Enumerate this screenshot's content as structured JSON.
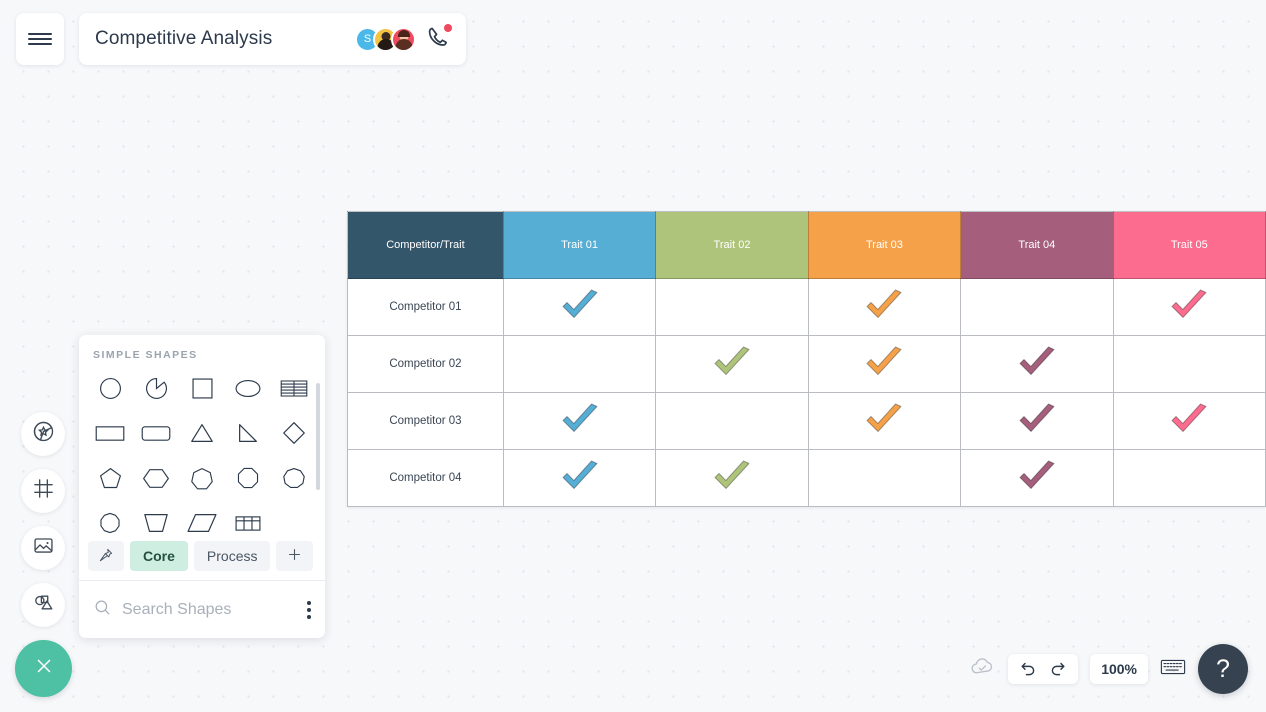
{
  "app": {
    "document_title": "Competitive Analysis"
  },
  "topbar": {
    "menu_icon": "hamburger-menu-icon",
    "phone_icon": "phone-call-icon",
    "collaborators": [
      {
        "initial": "S",
        "name": "collaborator-avatar-s",
        "color": "#4ab8e8"
      },
      {
        "initial": "",
        "name": "collaborator-avatar-2",
        "color": "#f5c344"
      },
      {
        "initial": "",
        "name": "collaborator-avatar-3",
        "color": "#f04a5e"
      }
    ]
  },
  "left_rail": {
    "items": [
      {
        "icon": "sticker-star-icon",
        "label": "Stickers"
      },
      {
        "icon": "frame-icon",
        "label": "Frame"
      },
      {
        "icon": "image-icon",
        "label": "Image"
      },
      {
        "icon": "shapes-icon",
        "label": "Shapes"
      }
    ],
    "close_icon": "close-x-icon",
    "close_color": "#4ec0a3"
  },
  "shapes_panel": {
    "heading": "SIMPLE SHAPES",
    "shapes": [
      "circle",
      "arc-partial-circle",
      "square",
      "ellipse",
      "table-striped",
      "rectangle",
      "rounded-rectangle",
      "triangle",
      "right-triangle",
      "diamond",
      "pentagon",
      "hexagon",
      "heptagon",
      "octagon",
      "nonagon",
      "decagon",
      "trapezoid",
      "parallelogram",
      "grid-table"
    ],
    "tabs": [
      {
        "label": "",
        "icon": "pin-icon",
        "active": false
      },
      {
        "label": "Core",
        "icon": "",
        "active": true
      },
      {
        "label": "Process",
        "icon": "",
        "active": false
      },
      {
        "label": "",
        "icon": "plus-icon",
        "active": false
      }
    ],
    "search_placeholder": "Search Shapes",
    "search_value": "",
    "search_icon": "search-icon",
    "more_icon": "more-vertical-icon"
  },
  "chart_data": {
    "type": "table",
    "title": "Competitive Analysis",
    "corner_label": "Competitor/Trait",
    "columns": [
      {
        "label": "Trait 01",
        "color": "#56aed5"
      },
      {
        "label": "Trait 02",
        "color": "#afc47b"
      },
      {
        "label": "Trait 03",
        "color": "#f5a council"
      },
      {
        "label": "Trait 04",
        "color": "#a55f7c"
      },
      {
        "label": "Trait 05",
        "color": "#fc6c8e"
      }
    ],
    "corner_color": "#34566b",
    "rows": [
      {
        "label": "Competitor 01",
        "marks": [
          true,
          false,
          true,
          false,
          true
        ]
      },
      {
        "label": "Competitor 02",
        "marks": [
          false,
          true,
          true,
          true,
          false
        ]
      },
      {
        "label": "Competitor 03",
        "marks": [
          true,
          false,
          true,
          true,
          true
        ]
      },
      {
        "label": "Competitor 04",
        "marks": [
          true,
          true,
          false,
          true,
          false
        ]
      }
    ],
    "mark_symbol": "checkmark"
  },
  "bottom_toolbar": {
    "cloud_icon": "cloud-saved-icon",
    "undo_icon": "undo-icon",
    "redo_icon": "redo-icon",
    "zoom_level": "100%",
    "keyboard_icon": "keyboard-shortcuts-icon",
    "help_label": "?",
    "help_icon": "help-question-icon"
  }
}
